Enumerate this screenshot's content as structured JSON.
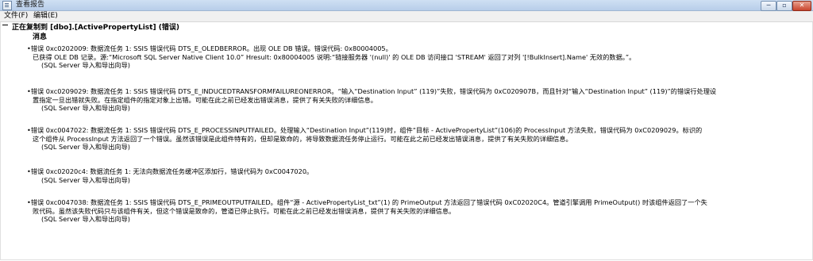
{
  "window": {
    "title": "查看报告",
    "controls": [
      "─",
      "▫",
      "✕"
    ]
  },
  "menu": {
    "file": "文件(F)",
    "edit": "编辑(E)"
  },
  "report": {
    "section_title": "正在复制到 [dbo].[ActivePropertyList] (错误)",
    "messages_heading": "消息",
    "errors": [
      {
        "lines": [
          "•错误 0xc0202009: 数据流任务 1: SSIS 错误代码 DTS_E_OLEDBERROR。出现 OLE DB 错误。错误代码: 0x80004005。",
          "已获得 OLE DB 记录。源:“Microsoft SQL Server Native Client 10.0” Hresult: 0x80004005 说明:“链接服务器 '(null)' 的 OLE DB 访问接口 'STREAM' 返回了对列 '[!BulkInsert].Name' 无效的数据。”。"
        ],
        "source": "(SQL Server 导入和导出向导)"
      },
      {
        "lines": [
          "•错误 0xc0209029: 数据流任务 1: SSIS 错误代码 DTS_E_INDUCEDTRANSFORMFAILUREONERROR。“输入“Destination Input” (119)”失败，错误代码为 0xC020907B，而且针对“输入“Destination Input” (119)”的错误行处理设",
          "置指定一旦出错就失败。在指定组件的指定对象上出错。可能在此之前已经发出错误消息，提供了有关失败的详细信息。"
        ],
        "source": "(SQL Server 导入和导出向导)"
      },
      {
        "lines": [
          "•错误 0xc0047022: 数据流任务 1: SSIS 错误代码 DTS_E_PROCESSINPUTFAILED。处理输入“Destination Input”(119)时，组件“目标 - ActivePropertyList”(106)的 ProcessInput 方法失败，错误代码为 0xC0209029。标识的",
          "这个组件从 ProcessInput 方法返回了一个错误。虽然该错误是此组件特有的，但却是致命的，将导致数据流任务停止运行。可能在此之前已经发出错误消息，提供了有关失败的详细信息。"
        ],
        "source": "(SQL Server 导入和导出向导)"
      },
      {
        "lines": [
          "•错误 0xc02020c4: 数据流任务 1: 无法向数据流任务缓冲区添加行，错误代码为 0xC0047020。"
        ],
        "source": "(SQL Server 导入和导出向导)"
      },
      {
        "lines": [
          "•错误 0xc0047038: 数据流任务 1: SSIS 错误代码 DTS_E_PRIMEOUTPUTFAILED。组件“源 - ActivePropertyList_txt”(1) 的 PrimeOutput 方法返回了错误代码 0xC02020C4。管道引擎调用 PrimeOutput() 时该组件返回了一个失",
          "败代码。虽然该失败代码只与该组件有关，但这个错误是致命的，管道已停止执行。可能在此之前已经发出错误消息，提供了有关失败的详细信息。"
        ],
        "source": "(SQL Server 导入和导出向导)"
      }
    ]
  }
}
